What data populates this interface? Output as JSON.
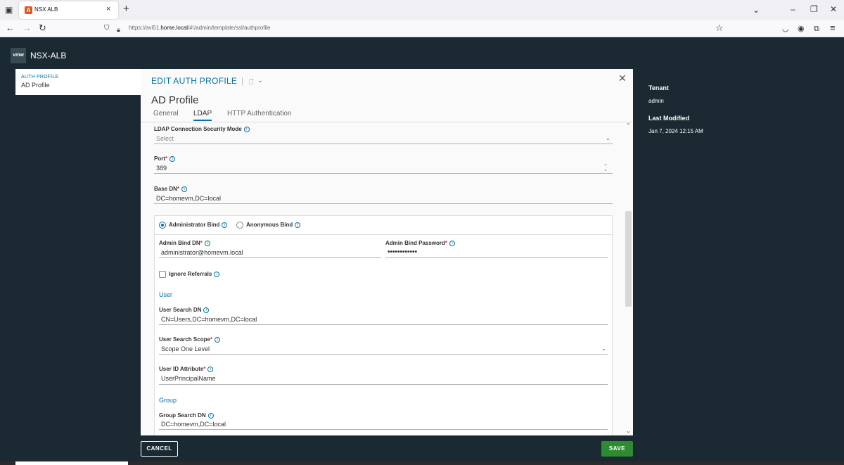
{
  "browser": {
    "tab_title": "NSX ALB",
    "tab_close": "×",
    "new_tab": "+",
    "url_prefix": "https://avi51.",
    "url_host": "home.local",
    "url_path": "/#!/admin/template/ssl/authprofile"
  },
  "app": {
    "logo": "vmw",
    "title": "NSX-ALB"
  },
  "breadcrumb": {
    "section": "AUTH PROFILE",
    "item": "AD Profile"
  },
  "sidepanel": {
    "tenant_label": "Tenant",
    "tenant_value": "admin",
    "modified_label": "Last Modified",
    "modified_value": "Jan 7, 2024 12:15 AM"
  },
  "modal": {
    "title": "EDIT AUTH PROFILE",
    "profile_name": "AD Profile",
    "tabs": [
      {
        "label": "General",
        "active": false
      },
      {
        "label": "LDAP",
        "active": true
      },
      {
        "label": "HTTP Authentication",
        "active": false
      }
    ]
  },
  "form": {
    "security_mode": {
      "label": "LDAP Connection Security Mode",
      "placeholder": "Select"
    },
    "port": {
      "label": "Port",
      "required": true,
      "value": "389"
    },
    "base_dn": {
      "label": "Base DN",
      "required": true,
      "value": "DC=homevm,DC=local"
    },
    "bind": {
      "admin_option": "Administrator Bind",
      "anon_option": "Anonymous Bind",
      "selected": "Administrator Bind"
    },
    "admin_bind_dn": {
      "label": "Admin Bind DN",
      "required": true,
      "value": "administrator@homevm.local"
    },
    "admin_bind_password": {
      "label": "Admin Bind Password",
      "required": true,
      "value": "••••••••••••"
    },
    "ignore_referrals": {
      "label": "Ignore Referrals",
      "checked": false
    },
    "user_section": "User",
    "user_search_dn": {
      "label": "User Search DN",
      "value": "CN=Users,DC=homevm,DC=local"
    },
    "user_search_scope": {
      "label": "User Search Scope",
      "required": true,
      "value": "Scope One Level"
    },
    "user_id_attribute": {
      "label": "User ID Attribute",
      "required": true,
      "value": "UserPrincipalName"
    },
    "group_section": "Group",
    "group_search_dn": {
      "label": "Group Search DN",
      "value": "DC=homevm,DC=local"
    }
  },
  "footer": {
    "cancel_label": "CANCEL",
    "save_label": "SAVE"
  },
  "colors": {
    "accent": "#0072a3",
    "header_bg": "#1b2a32",
    "save_green": "#2e8c30",
    "required_red": "#e02f2f"
  },
  "icons": [
    "firefox-view-icon",
    "back-icon",
    "forward-icon",
    "reload-icon",
    "shield-icon",
    "lock-icon",
    "bookmark-star-icon",
    "pocket-icon",
    "account-icon",
    "extensions-icon",
    "menu-icon",
    "info-icon",
    "chevron-down-icon",
    "close-icon",
    "document-icon"
  ]
}
